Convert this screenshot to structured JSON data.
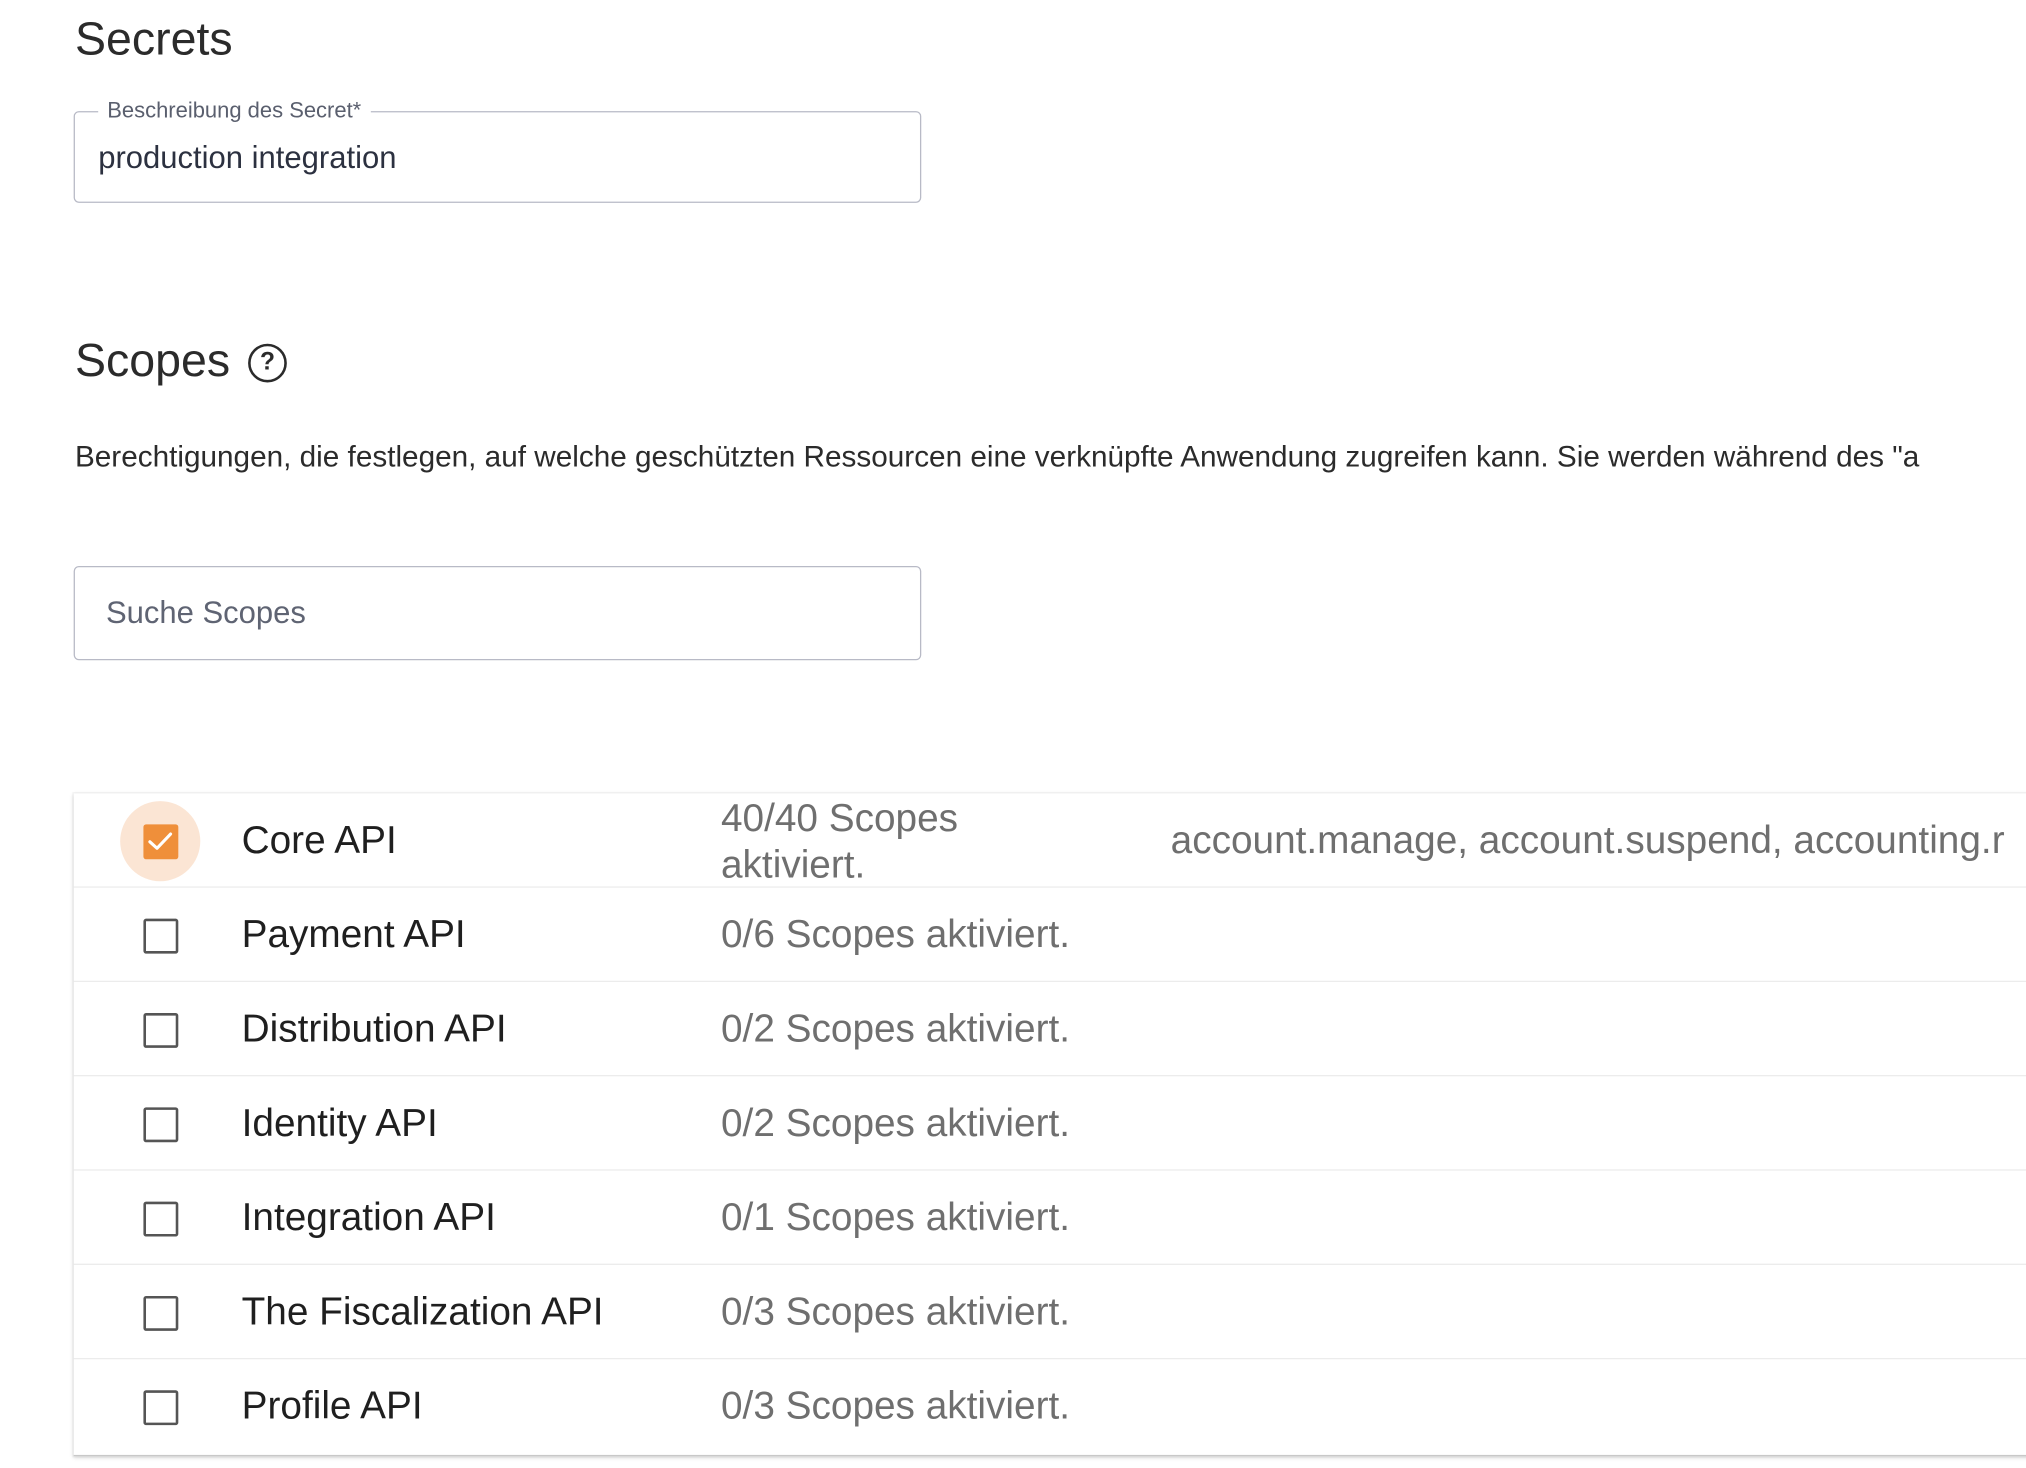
{
  "secrets": {
    "title": "Secrets",
    "description_field": {
      "label": "Beschreibung des Secret*",
      "value": "production integration"
    }
  },
  "scopes": {
    "title": "Scopes",
    "help_icon_glyph": "?",
    "description": "Berechtigungen, die festlegen, auf welche geschützten Ressourcen eine verknüpfte Anwendung zugreifen kann. Sie werden während des \"a",
    "search_placeholder": "Suche Scopes",
    "accent_color": "#ef8f3a",
    "rows": [
      {
        "name": "Core API",
        "status": "40/40 Scopes aktiviert.",
        "scope_list": "account.manage, account.suspend, accounting.r",
        "checked": true
      },
      {
        "name": "Payment API",
        "status": "0/6 Scopes aktiviert.",
        "scope_list": "",
        "checked": false
      },
      {
        "name": "Distribution API",
        "status": "0/2 Scopes aktiviert.",
        "scope_list": "",
        "checked": false
      },
      {
        "name": "Identity API",
        "status": "0/2 Scopes aktiviert.",
        "scope_list": "",
        "checked": false
      },
      {
        "name": "Integration API",
        "status": "0/1 Scopes aktiviert.",
        "scope_list": "",
        "checked": false
      },
      {
        "name": "The Fiscalization API",
        "status": "0/3 Scopes aktiviert.",
        "scope_list": "",
        "checked": false
      },
      {
        "name": "Profile API",
        "status": "0/3 Scopes aktiviert.",
        "scope_list": "",
        "checked": false
      }
    ]
  }
}
